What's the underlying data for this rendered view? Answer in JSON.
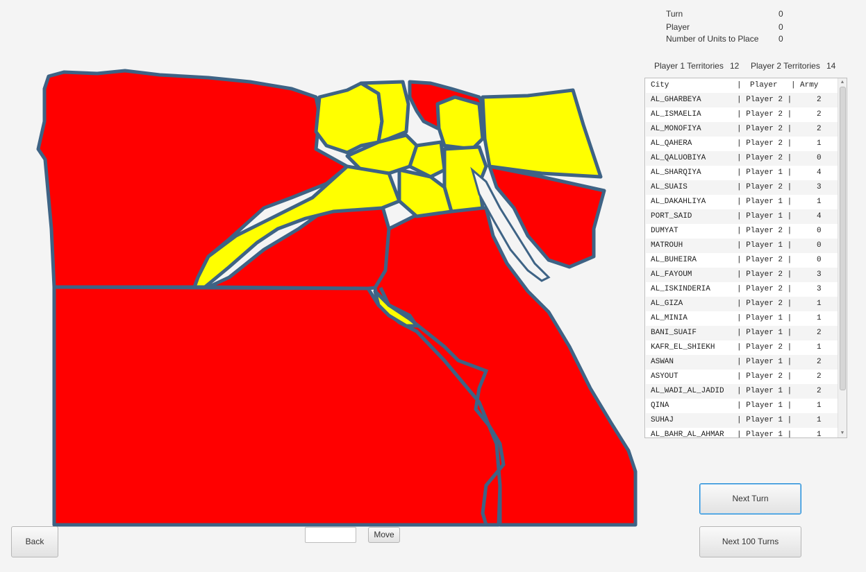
{
  "info": {
    "turn_label": "Turn",
    "turn_value": "0",
    "player_label": "Player",
    "player_value": "0",
    "units_label": "Number of Units to Place",
    "units_value": "0"
  },
  "territories": {
    "p1_label": "Player 1 Territories",
    "p1_value": "12",
    "p2_label": "Player 2 Territories",
    "p2_value": "14"
  },
  "table": {
    "header": {
      "city": "City",
      "sep1": "|",
      "player": "Player",
      "sep2": "|",
      "army": "Army"
    },
    "rows": [
      {
        "city": "AL_GHARBEYA",
        "player": "| Player 2 |",
        "army": "2"
      },
      {
        "city": "AL_ISMAELIA",
        "player": "| Player 2 |",
        "army": "2"
      },
      {
        "city": "AL_MONOFIYA",
        "player": "| Player 2 |",
        "army": "2"
      },
      {
        "city": "AL_QAHERA",
        "player": "| Player 2 |",
        "army": "1"
      },
      {
        "city": "AL_QALUOBIYA",
        "player": "| Player 2 |",
        "army": "0"
      },
      {
        "city": "AL_SHARQIYA",
        "player": "| Player 1 |",
        "army": "4"
      },
      {
        "city": "AL_SUAIS",
        "player": "| Player 2 |",
        "army": "3"
      },
      {
        "city": "AL_DAKAHLIYA",
        "player": "| Player 1 |",
        "army": "1"
      },
      {
        "city": "PORT_SAID",
        "player": "| Player 1 |",
        "army": "4"
      },
      {
        "city": "DUMYAT",
        "player": "| Player 2 |",
        "army": "0"
      },
      {
        "city": "MATROUH",
        "player": "| Player 1 |",
        "army": "0"
      },
      {
        "city": "AL_BUHEIRA",
        "player": "| Player 2 |",
        "army": "0"
      },
      {
        "city": "AL_FAYOUM",
        "player": "| Player 2 |",
        "army": "3"
      },
      {
        "city": "AL_ISKINDERIA",
        "player": "| Player 2 |",
        "army": "3"
      },
      {
        "city": "AL_GIZA",
        "player": "| Player 2 |",
        "army": "1"
      },
      {
        "city": "AL_MINIA",
        "player": "| Player 1 |",
        "army": "1"
      },
      {
        "city": "BANI_SUAIF",
        "player": "| Player 1 |",
        "army": "2"
      },
      {
        "city": "KAFR_EL_SHIEKH",
        "player": "| Player 2 |",
        "army": "1"
      },
      {
        "city": "ASWAN",
        "player": "| Player 1 |",
        "army": "2"
      },
      {
        "city": "ASYOUT",
        "player": "| Player 2 |",
        "army": "2"
      },
      {
        "city": "AL_WADI_AL_JADID",
        "player": "| Player 1 |",
        "army": "2"
      },
      {
        "city": "QINA",
        "player": "| Player 1 |",
        "army": "1"
      },
      {
        "city": "SUHAJ",
        "player": "| Player 1 |",
        "army": "1"
      },
      {
        "city": "AL_BAHR_AL_AHMAR",
        "player": "| Player 1 |",
        "army": "1"
      }
    ]
  },
  "buttons": {
    "next_turn": "Next Turn",
    "next_100": "Next 100 Turns",
    "back": "Back",
    "move": "Move"
  },
  "move_input": {
    "value": ""
  },
  "colors": {
    "player1": "#ff0000",
    "player2": "#ffff00",
    "border": "#3e6385",
    "background": "#f4f4f4"
  }
}
